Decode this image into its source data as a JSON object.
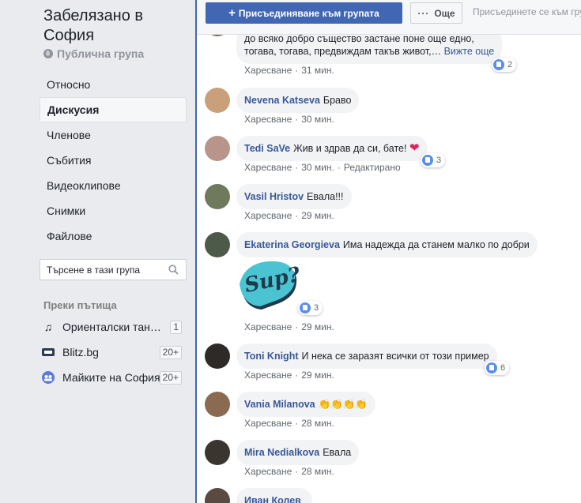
{
  "group": {
    "title": "Забелязано в София",
    "privacy": "Публична група"
  },
  "nav": [
    {
      "label": "Относно",
      "active": false
    },
    {
      "label": "Дискусия",
      "active": true
    },
    {
      "label": "Членове",
      "active": false
    },
    {
      "label": "Събития",
      "active": false
    },
    {
      "label": "Видеоклипове",
      "active": false
    },
    {
      "label": "Снимки",
      "active": false
    },
    {
      "label": "Файлове",
      "active": false
    }
  ],
  "search": {
    "placeholder": "Търсене в тази група"
  },
  "shortcuts": {
    "title": "Преки пътища",
    "items": [
      {
        "label": "Ориенталски танци …",
        "count": "1",
        "icon": "music-note-icon"
      },
      {
        "label": "Blitz.bg",
        "count": "20+",
        "icon": "blitz-logo-icon"
      },
      {
        "label": "Майките на София",
        "count": "20+",
        "icon": "group-icon"
      }
    ]
  },
  "top_bar": {
    "join_label": "Присъединяване към групата",
    "more_label": "Още",
    "join_hint": "Присъединете се към групата"
  },
  "actions": {
    "like": "Харесване",
    "edited": "Редактирано"
  },
  "comments": [
    {
      "name": "",
      "text_line1": "до всяко добро същество застане поне още едно,",
      "text_line2": "тогава, тогава, предвиждам такъв живот,…",
      "see_more": "Вижте още",
      "time": "31 мин.",
      "reactions": "2"
    },
    {
      "name": "Nevena Katseva",
      "text": "Браво",
      "time": "30 мин."
    },
    {
      "name": "Tedi SaVe",
      "text": "Жив и здрав да си, бате!",
      "emoji": "❤",
      "time": "30 мин.",
      "edited": true,
      "reactions": "3"
    },
    {
      "name": "Vasil Hristov",
      "text": "Евала!!!",
      "time": "29 мин."
    },
    {
      "name": "Ekaterina Georgieva",
      "text": "Има надежда да станем малко по добри",
      "sticker": "Sup?",
      "time": "29 мин.",
      "reactions": "3"
    },
    {
      "name": "Toni Knight",
      "text": "И нека се заразят всички от този пример",
      "time": "29 мин.",
      "reactions": "6"
    },
    {
      "name": "Vania Milanova",
      "text": "👏👏👏👏",
      "time": "28 мин."
    },
    {
      "name": "Mira Nedialkova",
      "text": "Евала",
      "time": "28 мин."
    },
    {
      "name": "Иван Колев",
      "text": "",
      "time": ""
    }
  ],
  "colors": {
    "brand": "#4267b2",
    "link": "#385898",
    "bubble": "#f2f3f5",
    "like": "#5b8def"
  }
}
